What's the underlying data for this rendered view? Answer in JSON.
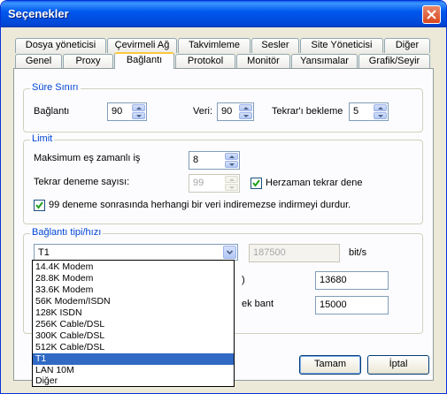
{
  "window": {
    "title": "Seçenekler"
  },
  "tabs_row1": [
    "Dosya yöneticisi",
    "Çevirmeli Ağ",
    "Takvimleme",
    "Sesler",
    "Site Yöneticisi",
    "Diğer"
  ],
  "tabs_row2": [
    "Genel",
    "Proxy",
    "Bağlantı",
    "Protokol",
    "Monitör",
    "Yansımalar",
    "Grafik/Seyir"
  ],
  "active_tab": "Bağlantı",
  "timeouts": {
    "group_title": "Süre Sınırı",
    "connection_label": "Bağlantı",
    "connection_value": "90",
    "data_label": "Veri:",
    "data_value": "90",
    "retry_wait_label": "Tekrar'ı bekleme",
    "retry_wait_value": "5"
  },
  "limit": {
    "group_title": "Limit",
    "max_concurrent_label": "Maksimum eş zamanlı iş",
    "max_concurrent_value": "8",
    "retry_count_label": "Tekrar deneme sayısı:",
    "retry_count_value": "99",
    "always_retry_label": "Herzaman tekrar dene",
    "always_retry_checked": true,
    "stop_after_label": "99 deneme sonrasında herhangi bir veri indiremezse indirmeyi durdur.",
    "stop_after_checked": true
  },
  "connection_type": {
    "group_title": "Bağlantı tipi/hızı",
    "selected": "T1",
    "speed_value": "187500",
    "speed_unit": "bit/s",
    "partial_label_1": ")",
    "field_1_value": "13680",
    "partial_label_2": "ek bant",
    "field_2_value": "15000",
    "options": [
      "14.4K Modem",
      "28.8K Modem",
      "33.6K Modem",
      "56K Modem/ISDN",
      "128K ISDN",
      "256K Cable/DSL",
      "300K Cable/DSL",
      "512K Cable/DSL",
      "T1",
      "LAN 10M",
      "Diğer"
    ]
  },
  "buttons": {
    "ok": "Tamam",
    "cancel": "İptal"
  },
  "colors": {
    "titlebar": "#0058ee",
    "group_title": "#0046d5",
    "selection": "#316ac5",
    "close_button": "#d8461d"
  }
}
